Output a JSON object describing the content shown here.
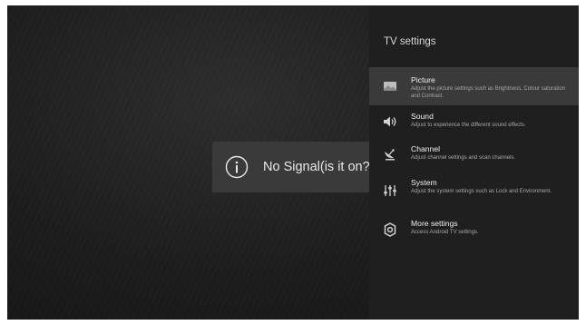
{
  "overlay": {
    "message": "No Signal(is it on?)",
    "icon": "info-icon"
  },
  "settings_panel": {
    "title": "TV settings",
    "items": [
      {
        "label": "Picture",
        "description": "Adjust the picture settings such as Brightness, Colour saturation and Contrast.",
        "icon": "picture-icon",
        "selected": true
      },
      {
        "label": "Sound",
        "description": "Adjust to experience the different sound effects.",
        "icon": "speaker-icon",
        "selected": false
      },
      {
        "label": "Channel",
        "description": "Adjust channel settings and scan channels.",
        "icon": "satellite-dish-icon",
        "selected": false
      },
      {
        "label": "System",
        "description": "Adjust the system settings such as Lock and Environment.",
        "icon": "sliders-icon",
        "selected": false
      },
      {
        "label": "More settings",
        "description": "Access Android TV settings.",
        "icon": "gear-icon",
        "selected": false
      }
    ]
  },
  "colors": {
    "panel_background": "#1f1f1f",
    "selected_item_background": "#3a3a3a",
    "overlay_background": "#3a3a3a"
  }
}
